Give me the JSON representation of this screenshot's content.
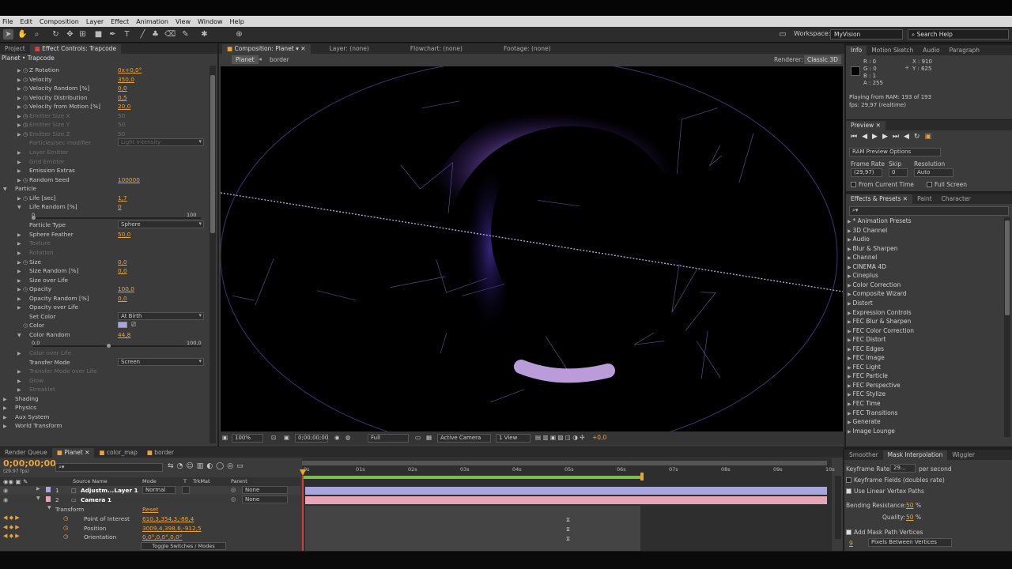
{
  "menu": [
    "File",
    "Edit",
    "Composition",
    "Layer",
    "Effect",
    "Animation",
    "View",
    "Window",
    "Help"
  ],
  "workspace": {
    "label": "Workspace:",
    "value": "MyVision",
    "search_placeholder": "Search Help"
  },
  "effect_controls": {
    "tabs": [
      "Project",
      "Effect Controls: Trapcode"
    ],
    "breadcrumb": "Planet • Trapcode",
    "rows": [
      {
        "label": "Z Rotation",
        "value": "0x+0,0°",
        "indent": 1,
        "stopwatch": true,
        "arrow": true
      },
      {
        "label": "Velocity",
        "value": "350,0",
        "indent": 1,
        "stopwatch": true,
        "arrow": true
      },
      {
        "label": "Velocity Random [%]",
        "value": "0,0",
        "indent": 1,
        "stopwatch": true,
        "arrow": true
      },
      {
        "label": "Velocity Distribution",
        "value": "0,5",
        "indent": 1,
        "stopwatch": true,
        "arrow": true
      },
      {
        "label": "Velocity from Motion [%]",
        "value": "20,0",
        "indent": 1,
        "stopwatch": true,
        "arrow": true
      },
      {
        "label": "Emitter Size X",
        "value": "50",
        "indent": 1,
        "stopwatch": true,
        "arrow": true,
        "dim": true
      },
      {
        "label": "Emitter Size Y",
        "value": "50",
        "indent": 1,
        "stopwatch": true,
        "arrow": true,
        "dim": true
      },
      {
        "label": "Emitter Size Z",
        "value": "50",
        "indent": 1,
        "stopwatch": true,
        "arrow": true,
        "dim": true
      },
      {
        "label": "Particles/sec modifier",
        "value": "Light Intensity",
        "indent": 1,
        "dim": true,
        "dropdown": true
      },
      {
        "label": "Layer Emitter",
        "value": "",
        "indent": 1,
        "arrow": true,
        "dim": true
      },
      {
        "label": "Grid Emitter",
        "value": "",
        "indent": 1,
        "arrow": true,
        "dim": true
      },
      {
        "label": "Emission Extras",
        "value": "",
        "indent": 1,
        "arrow": true
      },
      {
        "label": "Random Seed",
        "value": "100000",
        "indent": 1,
        "stopwatch": true,
        "arrow": true
      },
      {
        "label": "Particle",
        "value": "",
        "indent": 0,
        "arrow": true,
        "open": true
      },
      {
        "label": "Life [sec]",
        "value": "1,7",
        "indent": 1,
        "stopwatch": true,
        "arrow": true
      },
      {
        "label": "Life Random [%]",
        "value": "0",
        "indent": 1,
        "arrow": true,
        "open": true
      },
      {
        "label": "",
        "value": "",
        "slider": true,
        "min": "0",
        "max": "100",
        "pos": 0
      },
      {
        "label": "Particle Type",
        "value": "Sphere",
        "indent": 1,
        "dropdown": true
      },
      {
        "label": "Sphere Feather",
        "value": "50,0",
        "indent": 1,
        "arrow": true
      },
      {
        "label": "Texture",
        "value": "",
        "indent": 1,
        "arrow": true,
        "dim": true
      },
      {
        "label": "Rotation",
        "value": "",
        "indent": 1,
        "arrow": true,
        "dim": true
      },
      {
        "label": "Size",
        "value": "0,0",
        "indent": 1,
        "stopwatch": true,
        "arrow": true
      },
      {
        "label": "Size Random [%]",
        "value": "0,0",
        "indent": 1,
        "arrow": true
      },
      {
        "label": "Size over Life",
        "value": "",
        "indent": 1,
        "arrow": true
      },
      {
        "label": "Opacity",
        "value": "100,0",
        "indent": 1,
        "stopwatch": true,
        "arrow": true
      },
      {
        "label": "Opacity Random [%]",
        "value": "0,0",
        "indent": 1,
        "arrow": true
      },
      {
        "label": "Opacity over Life",
        "value": "",
        "indent": 1,
        "arrow": true
      },
      {
        "label": "Set Color",
        "value": "At Birth",
        "indent": 1,
        "dropdown": true
      },
      {
        "label": "Color",
        "value": "",
        "indent": 1,
        "stopwatch": true,
        "color": true
      },
      {
        "label": "Color Random",
        "value": "44,8",
        "indent": 1,
        "arrow": true,
        "open": true
      },
      {
        "label": "",
        "value": "",
        "slider": true,
        "min": "0,0",
        "max": "100,0",
        "pos": 0.448
      },
      {
        "label": "Color over Life",
        "value": "",
        "indent": 1,
        "arrow": true,
        "dim": true
      },
      {
        "label": "Transfer Mode",
        "value": "Screen",
        "indent": 1,
        "dropdown": true
      },
      {
        "label": "Transfer Mode over Life",
        "value": "",
        "indent": 1,
        "arrow": true,
        "dim": true
      },
      {
        "label": "Glow",
        "value": "",
        "indent": 1,
        "arrow": true,
        "dim": true
      },
      {
        "label": "Streaklet",
        "value": "",
        "indent": 1,
        "arrow": true,
        "dim": true
      },
      {
        "label": "Shading",
        "value": "",
        "indent": 0,
        "arrow": true
      },
      {
        "label": "Physics",
        "value": "",
        "indent": 0,
        "arrow": true
      },
      {
        "label": "Aux System",
        "value": "",
        "indent": 0,
        "arrow": true
      },
      {
        "label": "World Transform",
        "value": "",
        "indent": 0,
        "arrow": true
      }
    ]
  },
  "composition": {
    "tabs": [
      "Composition: Planet",
      "Layer: (none)",
      "Flowchart: (none)",
      "Footage: (none)"
    ],
    "crumbs": [
      "Planet",
      "border"
    ],
    "renderer_label": "Renderer:",
    "renderer": "Classic 3D",
    "zoom": "100%",
    "timecode": "0;00;00;00",
    "resolution": "Full",
    "view": "Active Camera",
    "views": "1 View",
    "exposure": "+0,0"
  },
  "info": {
    "tabs": [
      "Info",
      "Motion Sketch",
      "Audio",
      "Paragraph"
    ],
    "r": "R : 0",
    "g": "G : 0",
    "b": "B : 1",
    "a": "A : 255",
    "x": "X : 910",
    "y": "Y : 625",
    "line1": "Playing from RAM: 193 of 193",
    "line2": "fps: 29,97 (realtime)"
  },
  "preview": {
    "tab": "Preview",
    "options": "RAM Preview Options",
    "frame_rate_label": "Frame Rate",
    "skip_label": "Skip",
    "resolution_label": "Resolution",
    "frame_rate": "(29,97)",
    "skip": "0",
    "resolution": "Auto",
    "from_current": "From Current Time",
    "full_screen": "Full Screen"
  },
  "effects_presets": {
    "tabs": [
      "Effects & Presets",
      "Paint",
      "Character"
    ],
    "items": [
      "* Animation Presets",
      "3D Channel",
      "Audio",
      "Blur & Sharpen",
      "Channel",
      "CINEMA 4D",
      "Cineplus",
      "Color Correction",
      "Composite Wizard",
      "Distort",
      "Expression Controls",
      "FEC Blur & Sharpen",
      "FEC Color Correction",
      "FEC Distort",
      "FEC Edges",
      "FEC Image",
      "FEC Light",
      "FEC Particle",
      "FEC Perspective",
      "FEC Stylize",
      "FEC Time",
      "FEC Transitions",
      "Generate",
      "Image Lounge"
    ]
  },
  "timeline": {
    "tabs": [
      "Render Queue",
      "Planet",
      "color_map",
      "border"
    ],
    "timecode": "0;00;00;00",
    "fps": "(29.97 fps)",
    "headers": [
      "Source Name",
      "Mode",
      "T",
      "TrkMat",
      "Parent"
    ],
    "layers": [
      {
        "num": "1",
        "name": "Adjustm...Layer 1",
        "mode": "Normal",
        "parent": "None"
      },
      {
        "num": "2",
        "name": "Camera 1",
        "mode": "",
        "parent": "None"
      }
    ],
    "transform_label": "Transform",
    "reset": "Reset",
    "props": [
      {
        "name": "Point of Interest",
        "value": "610,3,354,3,-86,4"
      },
      {
        "name": "Position",
        "value": "3009,4,398,6,-912,5"
      },
      {
        "name": "Orientation",
        "value": "0,0°,0,0°,0,0°"
      }
    ],
    "ticks": [
      "0s",
      "01s",
      "02s",
      "03s",
      "04s",
      "05s",
      "06s",
      "07s",
      "08s",
      "09s",
      "10s"
    ],
    "toggle": "Toggle Switches / Modes"
  },
  "mask_panel": {
    "tabs": [
      "Smoother",
      "Mask Interpolation",
      "Wiggler"
    ],
    "keyframe_rate_label": "Keyframe Rate:",
    "keyframe_rate": "29...",
    "per_second": "per second",
    "keyframe_fields": "Keyframe Fields (doubles rate)",
    "linear_paths": "Use Linear Vertex Paths",
    "bending_label": "Bending Resistance:",
    "bending": "50",
    "bending_unit": "%",
    "quality_label": "Quality:",
    "quality": "50",
    "quality_unit": "%",
    "add_vertices": "Add Mask Path Vertices",
    "vertex_count": "9",
    "vertex_mode": "Pixels Between Vertices"
  },
  "colors": {
    "accent_value": "#e8a33a",
    "layer1_bar": "#a9a6df",
    "layer2_bar": "#e7a5b8",
    "work_area": "#7dbb4a"
  }
}
